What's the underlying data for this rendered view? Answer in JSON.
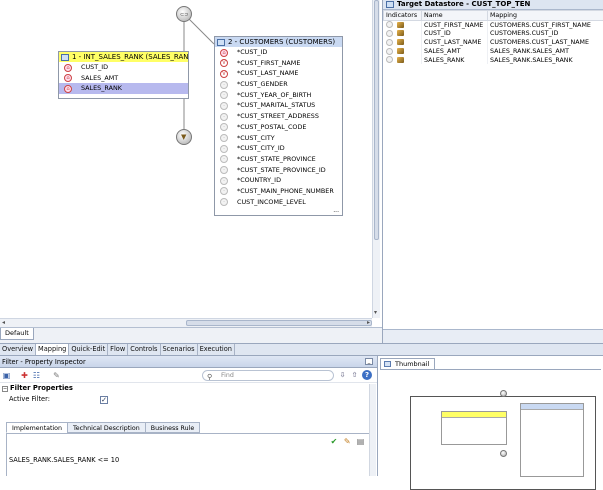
{
  "canvas": {
    "int_box": {
      "title": "1 - INT_SALES_RANK (SALES_RANK)",
      "rows": [
        {
          "icon": "key-icon",
          "label": "CUST_ID",
          "selected": false
        },
        {
          "icon": "key-icon",
          "label": "SALES_AMT",
          "selected": false
        },
        {
          "icon": "key-icon",
          "label": "SALES_RANK",
          "selected": true
        }
      ]
    },
    "customers_box": {
      "title": "2 - CUSTOMERS (CUSTOMERS)",
      "rows": [
        {
          "icon": "key",
          "label": "*CUST_ID"
        },
        {
          "icon": "v",
          "label": "*CUST_FIRST_NAME"
        },
        {
          "icon": "v",
          "label": "*CUST_LAST_NAME"
        },
        {
          "icon": "d",
          "label": "*CUST_GENDER"
        },
        {
          "icon": "d",
          "label": "*CUST_YEAR_OF_BIRTH"
        },
        {
          "icon": "d",
          "label": "*CUST_MARITAL_STATUS"
        },
        {
          "icon": "d",
          "label": "*CUST_STREET_ADDRESS"
        },
        {
          "icon": "d",
          "label": "*CUST_POSTAL_CODE"
        },
        {
          "icon": "d",
          "label": "*CUST_CITY"
        },
        {
          "icon": "d",
          "label": "*CUST_CITY_ID"
        },
        {
          "icon": "d",
          "label": "*CUST_STATE_PROVINCE"
        },
        {
          "icon": "d",
          "label": "*CUST_STATE_PROVINCE_ID"
        },
        {
          "icon": "d",
          "label": "*COUNTRY_ID"
        },
        {
          "icon": "d",
          "label": "*CUST_MAIN_PHONE_NUMBER"
        },
        {
          "icon": "d",
          "label": "CUST_INCOME_LEVEL"
        }
      ],
      "more": "..."
    },
    "tab": "Default"
  },
  "target": {
    "title": "Target Datastore - CUST_TOP_TEN",
    "columns": [
      "Indicators",
      "Name",
      "Mapping"
    ],
    "rows": [
      {
        "name": "CUST_FIRST_NAME",
        "mapping": "CUSTOMERS.CUST_FIRST_NAME"
      },
      {
        "name": "CUST_ID",
        "mapping": "CUSTOMERS.CUST_ID"
      },
      {
        "name": "CUST_LAST_NAME",
        "mapping": "CUSTOMERS.CUST_LAST_NAME"
      },
      {
        "name": "SALES_AMT",
        "mapping": "SALES_RANK.SALES_AMT"
      },
      {
        "name": "SALES_RANK",
        "mapping": "SALES_RANK.SALES_RANK"
      }
    ]
  },
  "editor_tabs": [
    "Overview",
    "Mapping",
    "Quick-Edit",
    "Flow",
    "Controls",
    "Scenarios",
    "Execution"
  ],
  "editor_tab_active": "Mapping",
  "inspector": {
    "title": "Filter - Property Inspector",
    "find_placeholder": "Find",
    "section": "Filter Properties",
    "active_filter_label": "Active Filter:",
    "active_filter_checked": true,
    "subtabs": [
      "Implementation",
      "Technical Description",
      "Business Rule"
    ],
    "subtab_active": "Implementation",
    "expression": "SALES_RANK.SALES_RANK <= 10"
  },
  "thumbnail": {
    "title": "Thumbnail"
  },
  "colors": {
    "selected_row": "#b7b9ee",
    "int_header": "#ffff66",
    "customers_header": "#c9d9f2"
  }
}
